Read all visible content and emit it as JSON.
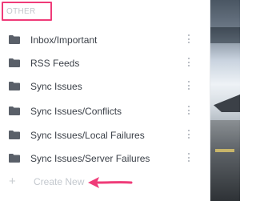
{
  "section": {
    "title": "OTHER"
  },
  "folders": [
    {
      "label": "Inbox/Important",
      "icon": "folder-icon",
      "menu_icon": "more-vertical-icon"
    },
    {
      "label": "RSS Feeds",
      "icon": "folder-icon",
      "menu_icon": "more-vertical-icon"
    },
    {
      "label": "Sync Issues",
      "icon": "folder-icon",
      "menu_icon": "more-vertical-icon"
    },
    {
      "label": "Sync Issues/Conflicts",
      "icon": "folder-icon",
      "menu_icon": "more-vertical-icon"
    },
    {
      "label": "Sync Issues/Local Failures",
      "icon": "folder-icon",
      "menu_icon": "more-vertical-icon"
    },
    {
      "label": "Sync Issues/Server Failures",
      "icon": "folder-icon",
      "menu_icon": "more-vertical-icon"
    }
  ],
  "create_new": {
    "label": "Create New",
    "icon": "plus-icon"
  },
  "colors": {
    "highlight": "#ef3b78",
    "folder_icon": "#5a6069",
    "text": "#3b4048",
    "muted_text": "#c3c8ce"
  }
}
